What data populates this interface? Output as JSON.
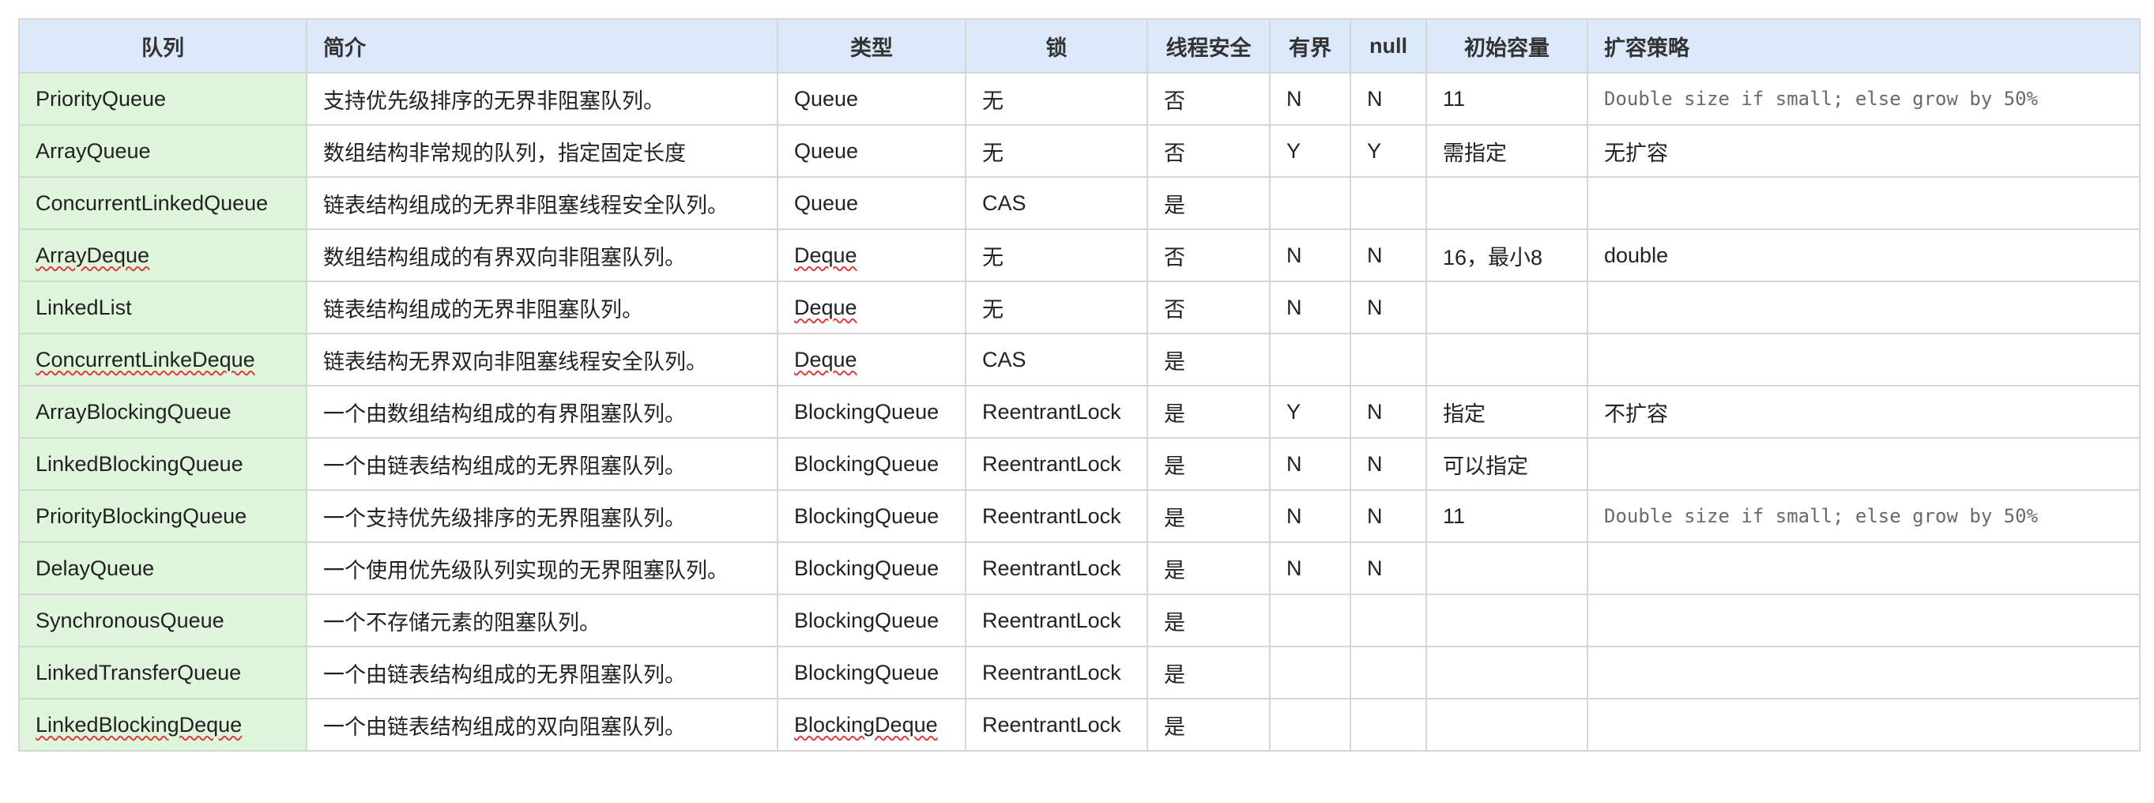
{
  "table": {
    "headers": [
      "队列",
      "简介",
      "类型",
      "锁",
      "线程安全",
      "有界",
      "null",
      "初始容量",
      "扩容策略"
    ],
    "rows": [
      {
        "name": "PriorityQueue",
        "name_flagged": false,
        "desc": "支持优先级排序的无界非阻塞队列。",
        "type": "Queue",
        "type_flagged": false,
        "lock": "无",
        "thread_safe": "否",
        "bounded": "N",
        "null": "N",
        "init_capacity": "11",
        "growth": "Double size if small; else grow by 50%",
        "growth_mono": true
      },
      {
        "name": "ArrayQueue",
        "name_flagged": false,
        "desc": "数组结构非常规的队列，指定固定长度",
        "type": "Queue",
        "type_flagged": false,
        "lock": "无",
        "thread_safe": "否",
        "bounded": "Y",
        "null": "Y",
        "init_capacity": "需指定",
        "growth": "无扩容",
        "growth_mono": false
      },
      {
        "name": "ConcurrentLinkedQueue",
        "name_flagged": false,
        "desc": "链表结构组成的无界非阻塞线程安全队列。",
        "type": "Queue",
        "type_flagged": false,
        "lock": "CAS",
        "thread_safe": "是",
        "bounded": "",
        "null": "",
        "init_capacity": "",
        "growth": "",
        "growth_mono": false
      },
      {
        "name": "ArrayDeque",
        "name_flagged": true,
        "desc": "数组结构组成的有界双向非阻塞队列。",
        "type": "Deque",
        "type_flagged": true,
        "lock": "无",
        "thread_safe": "否",
        "bounded": "N",
        "null": "N",
        "init_capacity": "16，最小8",
        "growth": "double",
        "growth_mono": false
      },
      {
        "name": "LinkedList",
        "name_flagged": false,
        "desc": "链表结构组成的无界非阻塞队列。",
        "type": "Deque",
        "type_flagged": true,
        "lock": "无",
        "thread_safe": "否",
        "bounded": "N",
        "null": "N",
        "init_capacity": "",
        "growth": "",
        "growth_mono": false
      },
      {
        "name": "ConcurrentLinkeDeque",
        "name_flagged": true,
        "desc": "链表结构无界双向非阻塞线程安全队列。",
        "type": "Deque",
        "type_flagged": true,
        "lock": "CAS",
        "thread_safe": "是",
        "bounded": "",
        "null": "",
        "init_capacity": "",
        "growth": "",
        "growth_mono": false
      },
      {
        "name": "ArrayBlockingQueue",
        "name_flagged": false,
        "desc": "一个由数组结构组成的有界阻塞队列。",
        "type": "BlockingQueue",
        "type_flagged": false,
        "lock": "ReentrantLock",
        "thread_safe": "是",
        "bounded": "Y",
        "null": "N",
        "init_capacity": "指定",
        "growth": "不扩容",
        "growth_mono": false
      },
      {
        "name": "LinkedBlockingQueue",
        "name_flagged": false,
        "desc": "一个由链表结构组成的无界阻塞队列。",
        "type": "BlockingQueue",
        "type_flagged": false,
        "lock": "ReentrantLock",
        "thread_safe": "是",
        "bounded": "N",
        "null": "N",
        "init_capacity": "可以指定",
        "growth": "",
        "growth_mono": false
      },
      {
        "name": "PriorityBlockingQueue",
        "name_flagged": false,
        "desc": "一个支持优先级排序的无界阻塞队列。",
        "type": "BlockingQueue",
        "type_flagged": false,
        "lock": "ReentrantLock",
        "thread_safe": "是",
        "bounded": "N",
        "null": "N",
        "init_capacity": "11",
        "growth": "Double size if small; else grow by 50%",
        "growth_mono": true
      },
      {
        "name": "DelayQueue",
        "name_flagged": false,
        "desc": "一个使用优先级队列实现的无界阻塞队列。",
        "type": "BlockingQueue",
        "type_flagged": false,
        "lock": "ReentrantLock",
        "thread_safe": "是",
        "bounded": "N",
        "null": "N",
        "init_capacity": "",
        "growth": "",
        "growth_mono": false
      },
      {
        "name": "SynchronousQueue",
        "name_flagged": false,
        "desc": "一个不存储元素的阻塞队列。",
        "type": "BlockingQueue",
        "type_flagged": false,
        "lock": "ReentrantLock",
        "thread_safe": "是",
        "bounded": "",
        "null": "",
        "init_capacity": "",
        "growth": "",
        "growth_mono": false
      },
      {
        "name": "LinkedTransferQueue",
        "name_flagged": false,
        "desc": "一个由链表结构组成的无界阻塞队列。",
        "type": "BlockingQueue",
        "type_flagged": false,
        "lock": "ReentrantLock",
        "thread_safe": "是",
        "bounded": "",
        "null": "",
        "init_capacity": "",
        "growth": "",
        "growth_mono": false
      },
      {
        "name": "LinkedBlockingDeque",
        "name_flagged": true,
        "desc": "一个由链表结构组成的双向阻塞队列。",
        "type": "BlockingDeque",
        "type_flagged": true,
        "lock": "ReentrantLock",
        "thread_safe": "是",
        "bounded": "",
        "null": "",
        "init_capacity": "",
        "growth": "",
        "growth_mono": false
      }
    ]
  }
}
